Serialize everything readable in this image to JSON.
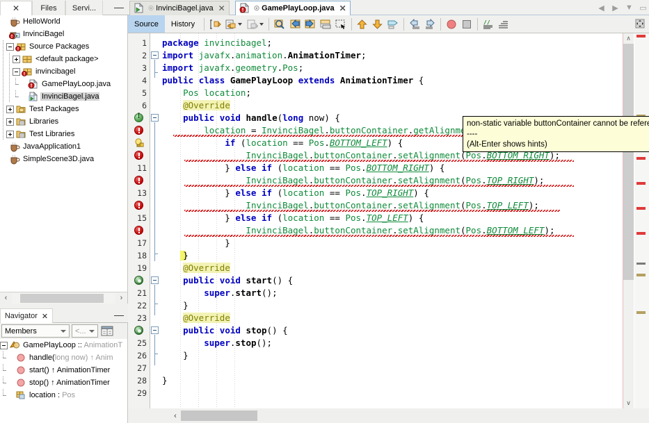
{
  "left_panel": {
    "tabs": [
      {
        "name": "projects",
        "label": "",
        "close": "✕",
        "active": true
      },
      {
        "name": "files",
        "label": "Files",
        "active": false
      },
      {
        "name": "services",
        "label": "Servi...",
        "active": false
      }
    ],
    "minimize": "—",
    "tree": [
      {
        "label": "HelloWorld",
        "icon": "coffee-cup-icon",
        "depth": 0,
        "toggle": "none",
        "selected": false
      },
      {
        "label": "InvinciBagel",
        "icon": "project-badge-icon",
        "depth": 0,
        "toggle": "none",
        "selected": false
      },
      {
        "label": "Source Packages",
        "icon": "source-packages-icon",
        "depth": 1,
        "toggle": "minus",
        "selected": false
      },
      {
        "label": "<default package>",
        "icon": "package-icon",
        "depth": 2,
        "toggle": "plus",
        "selected": false
      },
      {
        "label": "invincibagel",
        "icon": "package-badge-icon",
        "depth": 2,
        "toggle": "minus",
        "selected": false
      },
      {
        "label": "GamePlayLoop.java",
        "icon": "java-file-error-icon",
        "depth": 3,
        "toggle": "none",
        "selected": false
      },
      {
        "label": "InvinciBagel.java",
        "icon": "java-file-main-icon",
        "depth": 3,
        "toggle": "none",
        "selected": true
      },
      {
        "label": "Test Packages",
        "icon": "folder-test-icon",
        "depth": 1,
        "toggle": "plus",
        "selected": false
      },
      {
        "label": "Libraries",
        "icon": "libraries-icon",
        "depth": 1,
        "toggle": "plus",
        "selected": false
      },
      {
        "label": "Test Libraries",
        "icon": "libraries-icon",
        "depth": 1,
        "toggle": "plus",
        "selected": false
      },
      {
        "label": "JavaApplication1",
        "icon": "coffee-cup-icon",
        "depth": 0,
        "toggle": "none",
        "selected": false
      },
      {
        "label": "SimpleScene3D.java",
        "icon": "coffee-cup-icon",
        "depth": 0,
        "toggle": "none",
        "selected": false
      }
    ],
    "hscroll": {
      "left_arrow": "‹",
      "right_arrow": "›"
    }
  },
  "navigator": {
    "tab_label": "Navigator",
    "tab_close": "✕",
    "minimize": "—",
    "scope_value": "Members",
    "filter_value": "<...",
    "items": [
      {
        "label": "GamePlayLoop :: ",
        "suffix": "AnimationT",
        "icon": "class-icon",
        "depth": 0,
        "toggle": "minus"
      },
      {
        "label": "handle(",
        "mid": "long now",
        "suffix": ") ↑ Anim",
        "icon": "method-icon",
        "depth": 1,
        "toggle": "none"
      },
      {
        "label": "start() ↑ AnimationTimer",
        "icon": "method-icon",
        "depth": 1,
        "toggle": "none"
      },
      {
        "label": "stop() ↑ AnimationTimer",
        "icon": "method-icon",
        "depth": 1,
        "toggle": "none"
      },
      {
        "label": "location : ",
        "suffix": "Pos",
        "icon": "field-icon",
        "depth": 1,
        "toggle": "none"
      }
    ]
  },
  "editor": {
    "tabs": [
      {
        "label": "InvinciBagel.java",
        "icon": "java-file-main-icon",
        "close": "✕",
        "active": false
      },
      {
        "label": "GamePlayLoop.java",
        "icon": "java-file-error-icon",
        "close": "✕",
        "active": true
      }
    ],
    "window_nav": {
      "back": "◀",
      "forward": "▶",
      "dropdown": "▼",
      "maximize": "▭"
    },
    "view_tabs": [
      {
        "label": "Source",
        "selected": true
      },
      {
        "label": "History",
        "selected": false
      }
    ],
    "toolbar_icons": [
      "last-edit-icon",
      "toggle-bookmark-icon",
      "toggle-bookmark-dropdown",
      "previous-bookmark-icon",
      "previous-bookmark-dropdown",
      "find-selection-icon",
      "find-previous-icon",
      "find-next-icon",
      "toggle-highlight-icon",
      "toggle-rectangular-selection-icon",
      "shift-line-left-icon",
      "shift-line-right-icon",
      "shift-line-down-icon",
      "start-macro-icon",
      "stop-macro-icon",
      "comment-icon",
      "uncomment-icon"
    ],
    "right_toolbar_icon": "expand-icon",
    "code_lines": [
      {
        "num": "1",
        "glyph": "none",
        "text": "package invincibagel;"
      },
      {
        "num": "2",
        "glyph": "none",
        "text": "import javafx.animation.AnimationTimer;"
      },
      {
        "num": "3",
        "glyph": "none",
        "text": "import javafx.geometry.Pos;"
      },
      {
        "num": "4",
        "glyph": "none",
        "text": "public class GamePlayLoop extends AnimationTimer {"
      },
      {
        "num": "5",
        "glyph": "none",
        "text": "    Pos location;"
      },
      {
        "num": "6",
        "glyph": "none",
        "text": "    @Override"
      },
      {
        "num": "7",
        "glyph": "override",
        "text": "    public void handle(long now) {"
      },
      {
        "num": "8",
        "glyph": "error",
        "text": "        location = InvinciBagel.buttonContainer.getAlignment();"
      },
      {
        "num": "9",
        "glyph": "bulb",
        "text": "            if (location == Pos.BOTTOM_LEFT) {"
      },
      {
        "num": "10",
        "glyph": "error",
        "text": "                InvinciBagel.buttonContainer.setAlignment(Pos.BOTTOM_RIGHT);"
      },
      {
        "num": "11",
        "glyph": "none",
        "text": "            } else if (location == Pos.BOTTOM_RIGHT) {"
      },
      {
        "num": "12",
        "glyph": "error",
        "text": "                InvinciBagel.buttonContainer.setAlignment(Pos.TOP_RIGHT);"
      },
      {
        "num": "13",
        "glyph": "none",
        "text": "            } else if (location == Pos.TOP_RIGHT) {"
      },
      {
        "num": "14",
        "glyph": "error",
        "text": "                InvinciBagel.buttonContainer.setAlignment(Pos.TOP_LEFT);"
      },
      {
        "num": "15",
        "glyph": "none",
        "text": "            } else if (location == Pos.TOP_LEFT) {"
      },
      {
        "num": "16",
        "glyph": "error",
        "text": "                InvinciBagel.buttonContainer.setAlignment(Pos.BOTTOM_LEFT);"
      },
      {
        "num": "17",
        "glyph": "none",
        "text": "            }"
      },
      {
        "num": "18",
        "glyph": "none",
        "text": "    }"
      },
      {
        "num": "19",
        "glyph": "none",
        "text": "    @Override"
      },
      {
        "num": "20",
        "glyph": "impl",
        "text": "    public void start() {"
      },
      {
        "num": "21",
        "glyph": "none",
        "text": "        super.start();"
      },
      {
        "num": "22",
        "glyph": "none",
        "text": "    }"
      },
      {
        "num": "23",
        "glyph": "none",
        "text": "    @Override"
      },
      {
        "num": "24",
        "glyph": "impl",
        "text": "    public void stop() {"
      },
      {
        "num": "25",
        "glyph": "none",
        "text": "        super.stop();"
      },
      {
        "num": "26",
        "glyph": "none",
        "text": "    }"
      },
      {
        "num": "27",
        "glyph": "none",
        "text": ""
      },
      {
        "num": "28",
        "glyph": "none",
        "text": "}"
      },
      {
        "num": "29",
        "glyph": "none",
        "text": ""
      }
    ],
    "tooltip": {
      "line1": "non-static variable buttonContainer cannot be referenced from a static context",
      "line2": "----",
      "line3": "(Alt-Enter shows hints)"
    },
    "scrollbar": {
      "up": "∧",
      "down": "∨"
    },
    "hscroll": {
      "left_arrow": "‹"
    }
  },
  "colors": {
    "keyword": "#0000c0",
    "field": "#0f8b3a",
    "error": "#c40000",
    "annotation_bg": "#f3f3b6",
    "tooltip_bg": "#fdfdd8",
    "selected_tab": "#b8d4ef",
    "current_line": "#e3ebf5"
  }
}
